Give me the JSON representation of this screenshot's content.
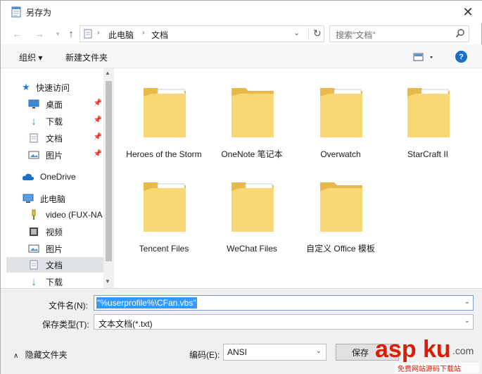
{
  "window": {
    "title": "另存为"
  },
  "nav": {
    "back_icon": "arrow-left-icon",
    "forward_icon": "arrow-right-icon",
    "up_icon": "arrow-up-icon",
    "breadcrumb": [
      "此电脑",
      "文档"
    ],
    "search_placeholder": "搜索\"文档\""
  },
  "toolbar": {
    "organize_label": "组织 ▾",
    "new_folder_label": "新建文件夹",
    "help_label": "?"
  },
  "sidebar": {
    "items": [
      {
        "label": "快速访问",
        "icon": "star-icon"
      },
      {
        "label": "桌面",
        "icon": "desktop-icon",
        "pinned": true
      },
      {
        "label": "下载",
        "icon": "download-icon",
        "pinned": true
      },
      {
        "label": "文档",
        "icon": "document-icon",
        "pinned": true
      },
      {
        "label": "图片",
        "icon": "picture-icon",
        "pinned": true
      },
      {
        "label": "OneDrive",
        "icon": "cloud-icon"
      },
      {
        "label": "此电脑",
        "icon": "computer-icon"
      },
      {
        "label": "video (FUX-NA",
        "icon": "network-drive-icon"
      },
      {
        "label": "视频",
        "icon": "video-icon"
      },
      {
        "label": "图片",
        "icon": "picture-icon"
      },
      {
        "label": "文档",
        "icon": "document-icon",
        "selected": true
      },
      {
        "label": "下载",
        "icon": "download-icon"
      }
    ]
  },
  "folders": [
    {
      "label": "Heroes of the Storm",
      "variant": "doc"
    },
    {
      "label": "OneNote 笔记本",
      "variant": "plain"
    },
    {
      "label": "Overwatch",
      "variant": "images"
    },
    {
      "label": "StarCraft II",
      "variant": "doc"
    },
    {
      "label": "Tencent Files",
      "variant": "images"
    },
    {
      "label": "WeChat Files",
      "variant": "images"
    },
    {
      "label": "自定义 Office 模板",
      "variant": "plain"
    }
  ],
  "form": {
    "filename_label": "文件名(N):",
    "filename_value": "\"%userprofile%\\CFan.vbs\"",
    "savetype_label": "保存类型(T):",
    "savetype_value": "文本文档(*.txt)",
    "hide_folders_label": "隐藏文件夹",
    "encoding_label": "编码(E):",
    "encoding_value": "ANSI",
    "save_label": "保存"
  },
  "watermark": {
    "text": "aspku.com",
    "subtext": "免费网站源码下载站"
  },
  "colors": {
    "accent": "#1c6fc7",
    "selection": "#3399ff",
    "folder": "#f8d775",
    "watermark_red": "#d81e06"
  }
}
